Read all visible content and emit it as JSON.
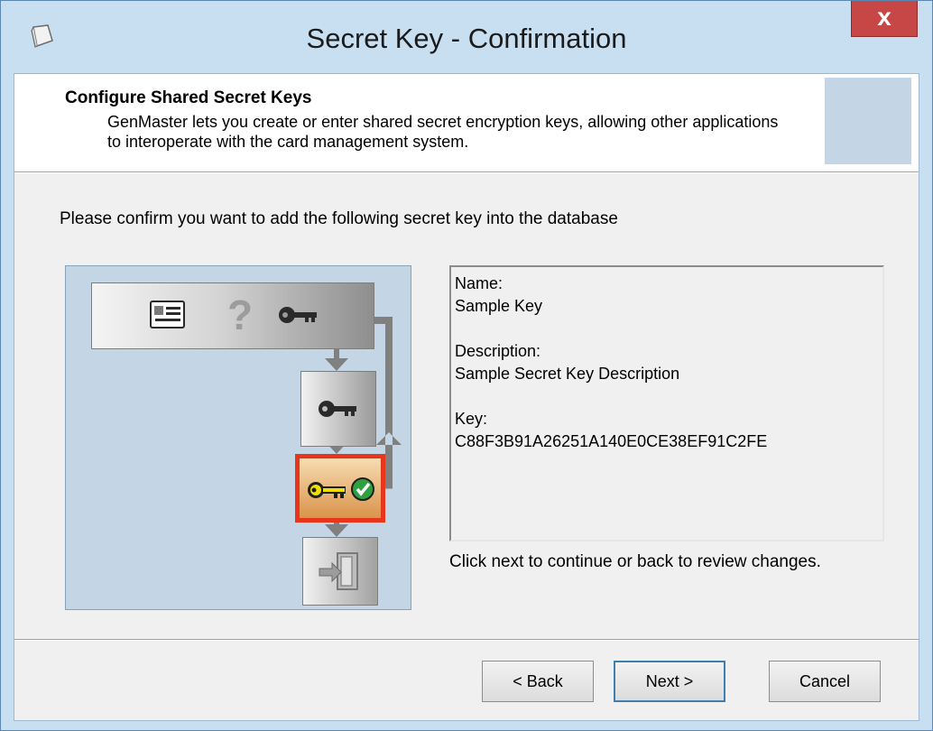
{
  "window": {
    "title": "Secret Key - Confirmation",
    "close_label": "x"
  },
  "header": {
    "title": "Configure Shared Secret Keys",
    "description": "GenMaster lets you create or enter shared secret encryption keys, allowing other applications to interoperate with the card management system."
  },
  "main": {
    "prompt": "Please confirm you want to add the following secret key into the database",
    "details": {
      "name_label": "Name:",
      "name_value": "Sample Key",
      "description_label": "Description:",
      "description_value": "Sample Secret Key Description",
      "key_label": "Key:",
      "key_value": "C88F3B91A26251A140E0CE38EF91C2FE"
    },
    "hint": "Click next to continue or back to review changes."
  },
  "wizard_steps": {
    "question_mark": "?",
    "icons": [
      "id-card-icon",
      "question-icon",
      "key-icon",
      "key-icon",
      "key-check-icon",
      "exit-door-icon"
    ]
  },
  "buttons": {
    "back": "< Back",
    "next": "Next >",
    "cancel": "Cancel"
  },
  "colors": {
    "title_bar": "#c8dff2",
    "close_button": "#c74646",
    "active_step_border": "#e8361c",
    "panel_background": "#c4d5e6",
    "default_button_border": "#3c7fb1"
  }
}
